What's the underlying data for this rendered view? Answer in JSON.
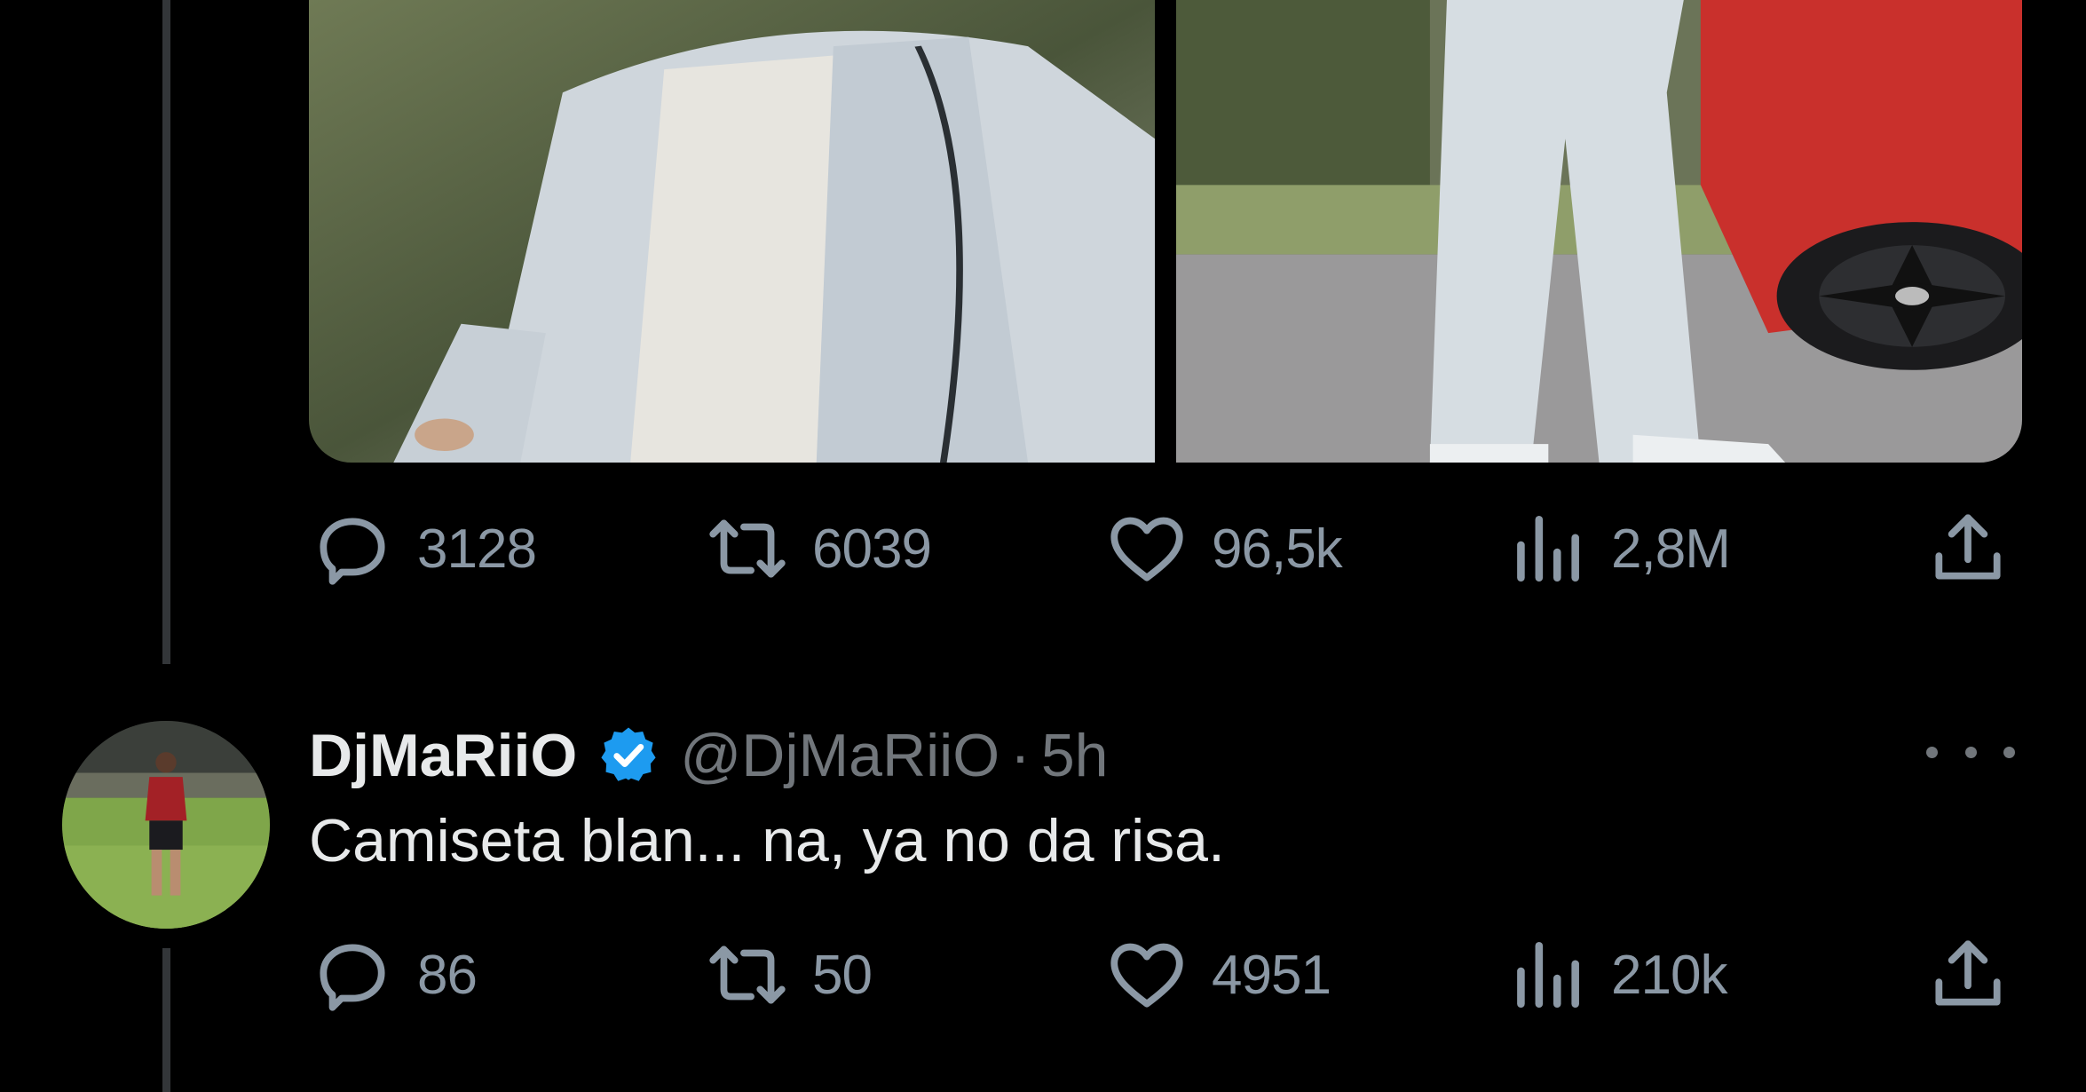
{
  "colors": {
    "background": "#000000",
    "text_primary": "#e7e9ea",
    "text_secondary": "#71767b",
    "icon": "#8b98a5",
    "verified": "#1d9bf0",
    "thread_line": "#333639"
  },
  "previous_tweet": {
    "media": [
      {
        "description_icon": "photo-person-white-jacket"
      },
      {
        "description_icon": "photo-person-white-pants-red-car"
      }
    ],
    "actions": {
      "replies": "3128",
      "retweets": "6039",
      "likes": "96,5k",
      "views": "2,8M"
    }
  },
  "reply_tweet": {
    "display_name": "DjMaRiiO",
    "handle": "@DjMaRiiO",
    "separator": "·",
    "time": "5h",
    "text": "Camiseta blan... na, ya no da risa.",
    "actions": {
      "replies": "86",
      "retweets": "50",
      "likes": "4951",
      "views": "210k"
    }
  },
  "icons": {
    "reply": "reply-icon",
    "retweet": "retweet-icon",
    "like": "heart-icon",
    "views": "views-icon",
    "share": "share-icon",
    "verified": "verified-badge-icon",
    "more": "more-icon"
  }
}
